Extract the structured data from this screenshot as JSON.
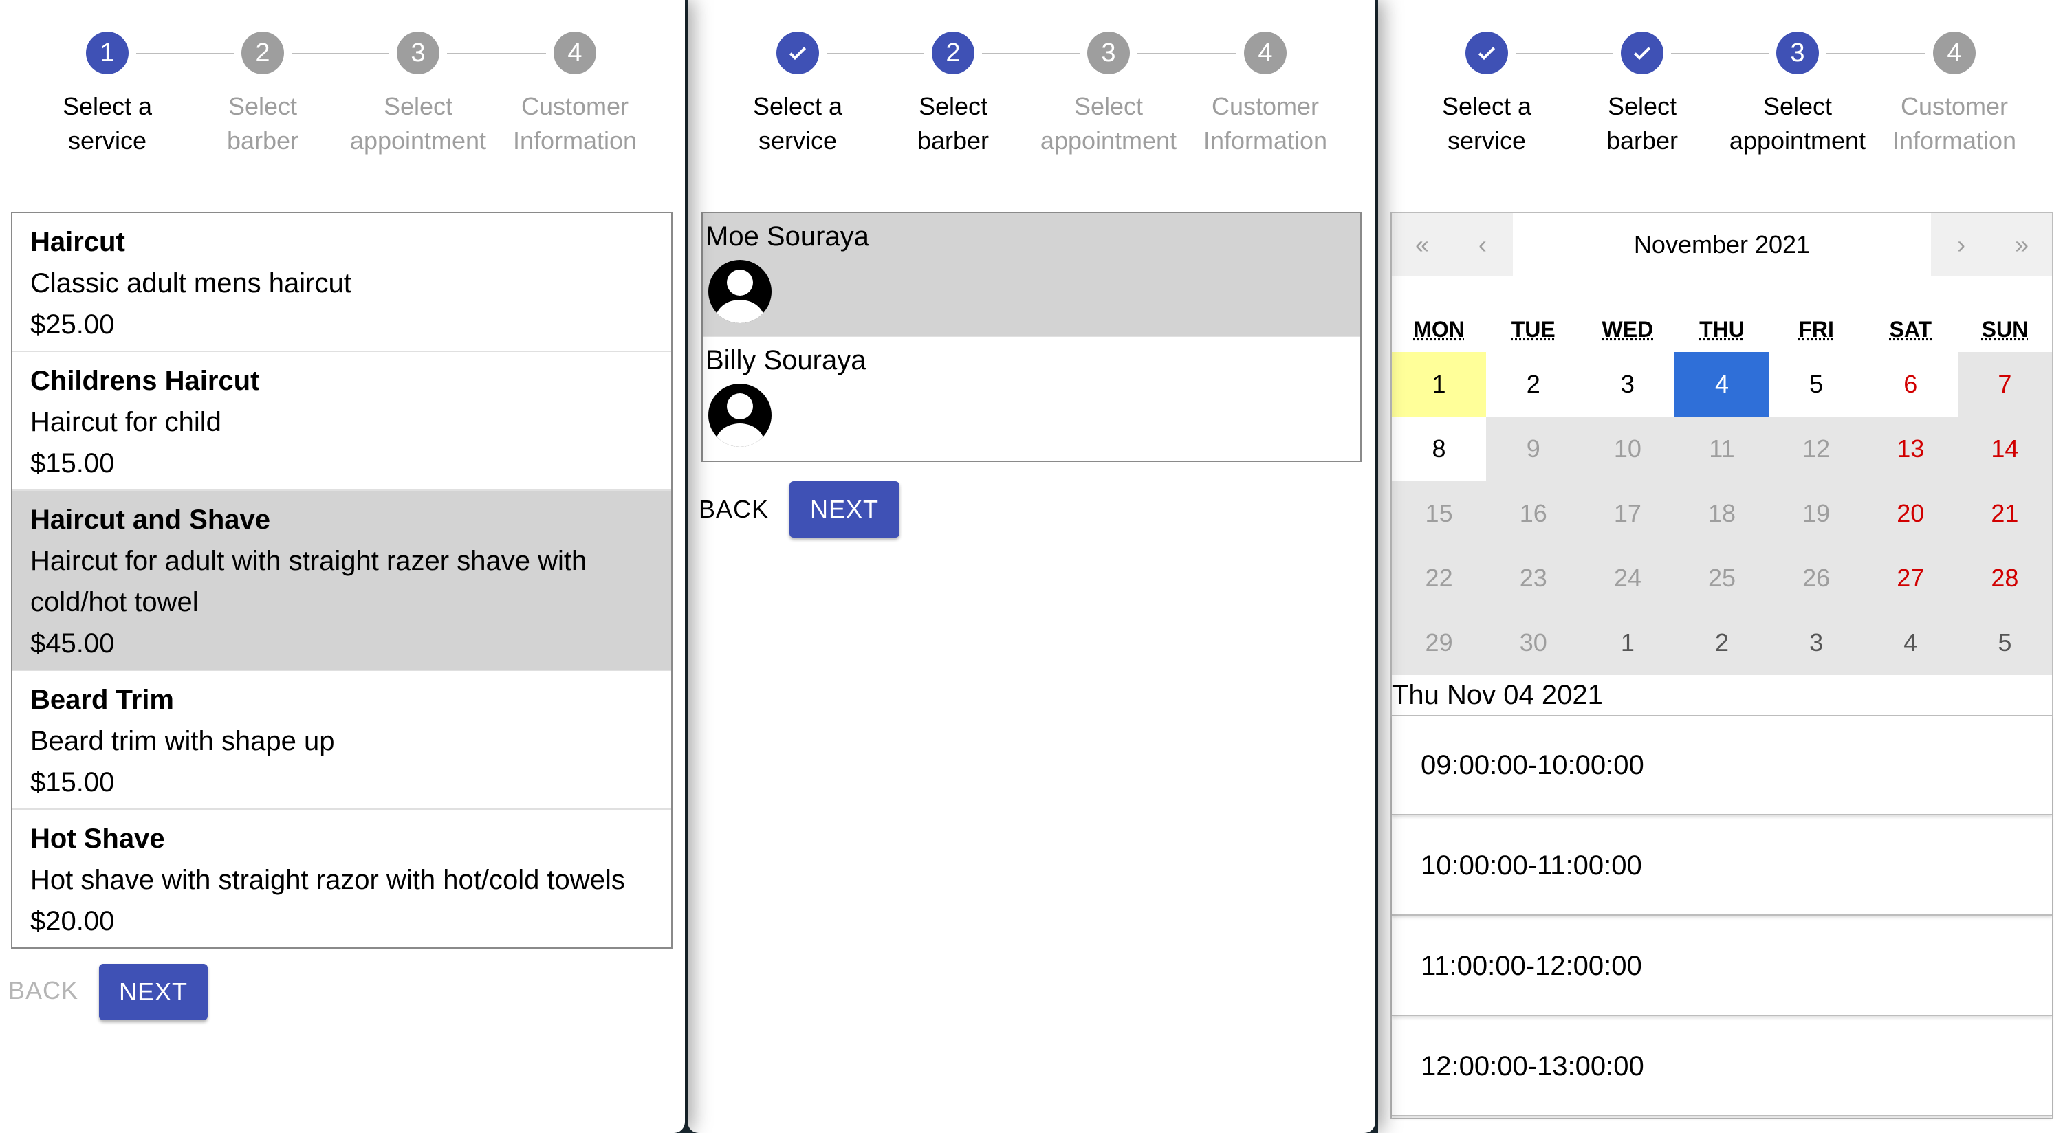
{
  "panels": [
    {
      "steps": [
        {
          "num": "1",
          "label": "Select a\nservice",
          "state": "active"
        },
        {
          "num": "2",
          "label": "Select\nbarber",
          "state": "todo"
        },
        {
          "num": "3",
          "label": "Select\nappointment",
          "state": "todo"
        },
        {
          "num": "4",
          "label": "Customer\nInformation",
          "state": "todo"
        }
      ]
    },
    {
      "steps": [
        {
          "num": "1",
          "label": "Select a\nservice",
          "state": "done"
        },
        {
          "num": "2",
          "label": "Select\nbarber",
          "state": "active"
        },
        {
          "num": "3",
          "label": "Select\nappointment",
          "state": "todo"
        },
        {
          "num": "4",
          "label": "Customer\nInformation",
          "state": "todo"
        }
      ]
    },
    {
      "steps": [
        {
          "num": "1",
          "label": "Select a\nservice",
          "state": "done"
        },
        {
          "num": "2",
          "label": "Select\nbarber",
          "state": "done"
        },
        {
          "num": "3",
          "label": "Select\nappointment",
          "state": "active"
        },
        {
          "num": "4",
          "label": "Customer\nInformation",
          "state": "todo"
        }
      ]
    }
  ],
  "services": [
    {
      "name": "Haircut",
      "desc": "Classic adult mens haircut",
      "price": "$25.00",
      "selected": false
    },
    {
      "name": "Childrens Haircut",
      "desc": "Haircut for child",
      "price": "$15.00",
      "selected": false
    },
    {
      "name": "Haircut and Shave",
      "desc": "Haircut for adult with straight razer shave with cold/hot towel",
      "price": "$45.00",
      "selected": true
    },
    {
      "name": "Beard Trim",
      "desc": "Beard trim with shape up",
      "price": "$15.00",
      "selected": false
    },
    {
      "name": "Hot Shave",
      "desc": "Hot shave with straight razor with hot/cold towels",
      "price": "$20.00",
      "selected": false
    }
  ],
  "barbers": [
    {
      "name": "Moe Souraya",
      "selected": true
    },
    {
      "name": "Billy Souraya",
      "selected": false
    }
  ],
  "buttons": {
    "back": "BACK",
    "next": "NEXT"
  },
  "calendar": {
    "nav": {
      "first": "«",
      "prev": "‹",
      "next": "›",
      "last": "»"
    },
    "title": "November 2021",
    "weekdays": [
      "MON",
      "TUE",
      "WED",
      "THU",
      "FRI",
      "SAT",
      "SUN"
    ],
    "days": [
      [
        "1",
        "today"
      ],
      [
        "2",
        "avail"
      ],
      [
        "3",
        "avail"
      ],
      [
        "4",
        "selected"
      ],
      [
        "5",
        "avail"
      ],
      [
        "6",
        "avail weekend"
      ],
      [
        "7",
        "weekend"
      ],
      [
        "8",
        "avail"
      ],
      [
        "9",
        ""
      ],
      [
        "10",
        ""
      ],
      [
        "11",
        ""
      ],
      [
        "12",
        ""
      ],
      [
        "13",
        "weekend"
      ],
      [
        "14",
        "weekend"
      ],
      [
        "15",
        ""
      ],
      [
        "16",
        ""
      ],
      [
        "17",
        ""
      ],
      [
        "18",
        ""
      ],
      [
        "19",
        ""
      ],
      [
        "20",
        "weekend"
      ],
      [
        "21",
        "weekend"
      ],
      [
        "22",
        ""
      ],
      [
        "23",
        ""
      ],
      [
        "24",
        ""
      ],
      [
        "25",
        ""
      ],
      [
        "26",
        ""
      ],
      [
        "27",
        "weekend"
      ],
      [
        "28",
        "weekend"
      ],
      [
        "29",
        ""
      ],
      [
        "30",
        ""
      ],
      [
        "1",
        "next"
      ],
      [
        "2",
        "next"
      ],
      [
        "3",
        "next"
      ],
      [
        "4",
        "next"
      ],
      [
        "5",
        "next"
      ]
    ],
    "selected_date": "Thu Nov 04 2021",
    "slots": [
      "09:00:00-10:00:00",
      "10:00:00-11:00:00",
      "11:00:00-12:00:00",
      "12:00:00-13:00:00"
    ]
  },
  "colors": {
    "primary": "#3f51b5",
    "selected_day": "#2f6fd8",
    "today": "#ffff99",
    "weekend": "#d10000",
    "selected_row": "#d3d3d3"
  }
}
